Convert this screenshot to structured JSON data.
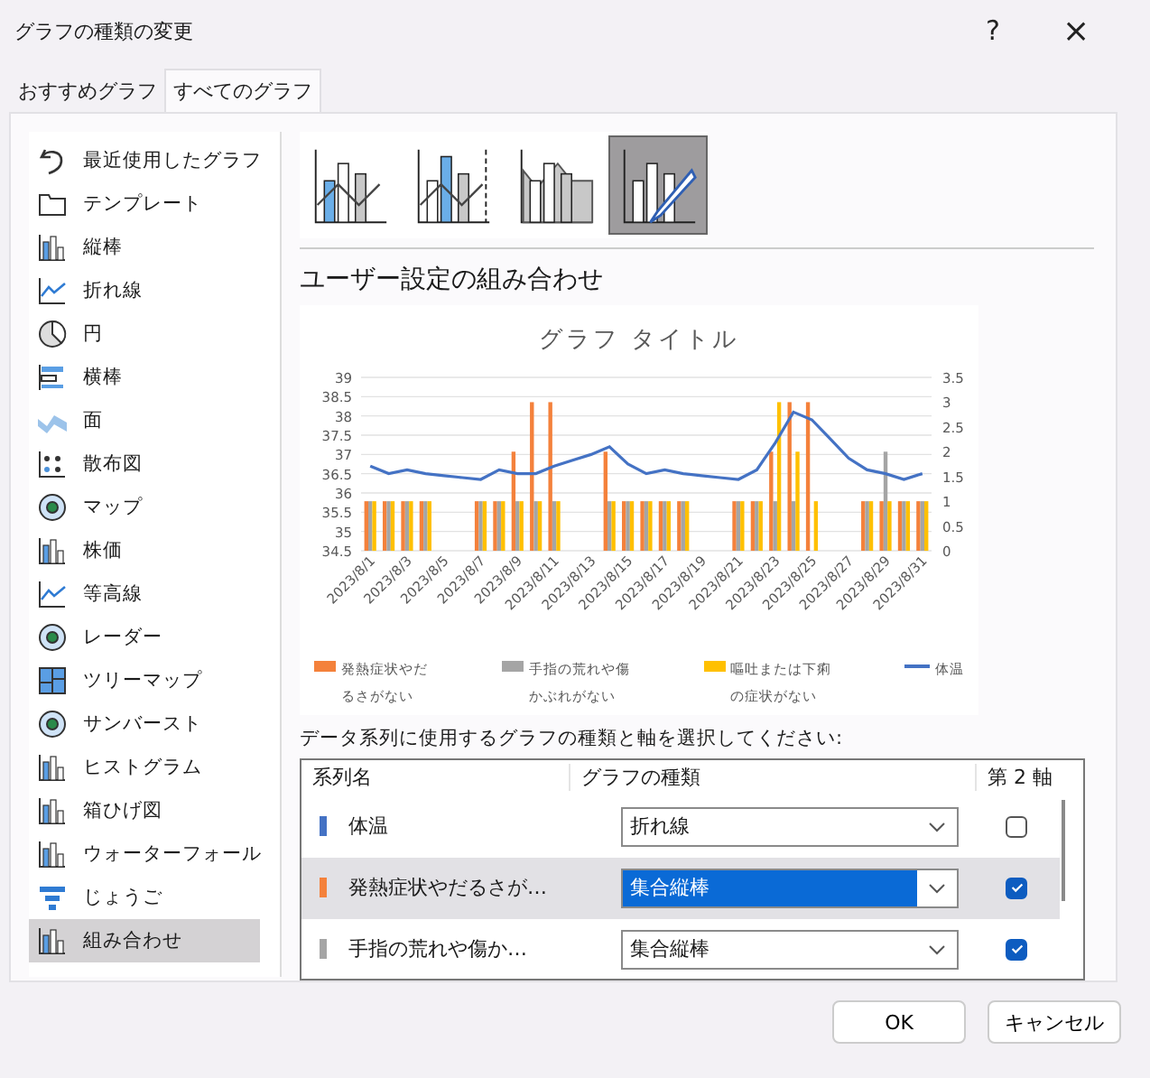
{
  "window": {
    "title": "グラフの種類の変更",
    "help": "?",
    "close": "×"
  },
  "tabs": [
    {
      "label": "おすすめグラフ",
      "selected": false
    },
    {
      "label": "すべてのグラフ",
      "selected": true
    }
  ],
  "sidebar": {
    "items": [
      {
        "label": "最近使用したグラフ",
        "selected": false
      },
      {
        "label": "テンプレート",
        "selected": false
      },
      {
        "label": "縦棒",
        "selected": false
      },
      {
        "label": "折れ線",
        "selected": false
      },
      {
        "label": "円",
        "selected": false
      },
      {
        "label": "横棒",
        "selected": false
      },
      {
        "label": "面",
        "selected": false
      },
      {
        "label": "散布図",
        "selected": false
      },
      {
        "label": "マップ",
        "selected": false
      },
      {
        "label": "株価",
        "selected": false
      },
      {
        "label": "等高線",
        "selected": false
      },
      {
        "label": "レーダー",
        "selected": false
      },
      {
        "label": "ツリーマップ",
        "selected": false
      },
      {
        "label": "サンバースト",
        "selected": false
      },
      {
        "label": "ヒストグラム",
        "selected": false
      },
      {
        "label": "箱ひげ図",
        "selected": false
      },
      {
        "label": "ウォーターフォール",
        "selected": false
      },
      {
        "label": "じょうご",
        "selected": false
      },
      {
        "label": "組み合わせ",
        "selected": true
      }
    ]
  },
  "subtypes": [
    {
      "selected": false
    },
    {
      "selected": false
    },
    {
      "selected": false
    },
    {
      "selected": true
    }
  ],
  "heading": "ユーザー設定の組み合わせ",
  "preview": {
    "chart_data": {
      "type": "bar",
      "title": "グラフ タイトル",
      "stacked": false,
      "grid": true,
      "legend": "bottom",
      "categories": [
        "2023/8/1",
        null,
        "2023/8/3",
        null,
        "2023/8/5",
        null,
        "2023/8/7",
        null,
        "2023/8/9",
        null,
        "2023/8/11",
        null,
        "2023/8/13",
        null,
        "2023/8/15",
        null,
        "2023/8/17",
        null,
        "2023/8/19",
        null,
        "2023/8/21",
        null,
        "2023/8/23",
        null,
        "2023/8/25",
        null,
        "2023/8/27",
        null,
        "2023/8/29",
        null,
        "2023/8/31"
      ],
      "ylim": [
        34.5,
        39
      ],
      "yticks": [
        {
          "value": 34.5,
          "label": "34.5"
        },
        {
          "value": 35,
          "label": "35"
        },
        {
          "value": 35.5,
          "label": "35.5"
        },
        {
          "value": 36,
          "label": "36"
        },
        {
          "value": 36.5,
          "label": "36.5"
        },
        {
          "value": 37,
          "label": "37"
        },
        {
          "value": 37.5,
          "label": "37.5"
        },
        {
          "value": 38,
          "label": "38"
        },
        {
          "value": 38.5,
          "label": "38.5"
        },
        {
          "value": 39,
          "label": "39"
        }
      ],
      "y2lim": [
        0,
        3.5
      ],
      "y2ticks": [
        {
          "value": 0,
          "label": "0"
        },
        {
          "value": 0.5,
          "label": "0.5"
        },
        {
          "value": 1,
          "label": "1"
        },
        {
          "value": 1.5,
          "label": "1.5"
        },
        {
          "value": 2,
          "label": "2"
        },
        {
          "value": 2.5,
          "label": "2.5"
        },
        {
          "value": 3,
          "label": "3"
        },
        {
          "value": 3.5,
          "label": "3.5"
        }
      ],
      "series": [
        {
          "name": "発熱症状やだるさがない",
          "color": "#f4813b",
          "type": "bar",
          "axis": "y2",
          "values": [
            1,
            1,
            1,
            1,
            null,
            null,
            1,
            1,
            2,
            3,
            3,
            null,
            null,
            2,
            1,
            1,
            1,
            1,
            null,
            null,
            1,
            1,
            2,
            3,
            3,
            null,
            null,
            1,
            1,
            1,
            1
          ]
        },
        {
          "name": "手指の荒れや傷かぶれがない",
          "color": "#a5a5a5",
          "type": "bar",
          "axis": "y2",
          "values": [
            1,
            1,
            1,
            1,
            null,
            null,
            1,
            1,
            1,
            1,
            1,
            null,
            null,
            1,
            1,
            1,
            1,
            1,
            null,
            null,
            1,
            1,
            1,
            1,
            null,
            null,
            null,
            1,
            2,
            1,
            1
          ]
        },
        {
          "name": "嘔吐または下痢の症状がない",
          "color": "#ffc000",
          "type": "bar",
          "axis": "y2",
          "values": [
            1,
            1,
            1,
            1,
            null,
            null,
            1,
            1,
            1,
            1,
            1,
            null,
            null,
            1,
            1,
            1,
            1,
            1,
            null,
            null,
            1,
            1,
            3,
            2,
            1,
            null,
            null,
            1,
            1,
            1,
            1
          ]
        },
        {
          "name": "体温",
          "color": "#4472c4",
          "type": "line",
          "values": [
            36.7,
            36.5,
            36.6,
            36.5,
            36.45,
            36.4,
            36.35,
            36.6,
            36.5,
            36.5,
            36.7,
            36.85,
            37.0,
            37.2,
            36.75,
            36.5,
            36.6,
            36.5,
            36.45,
            36.4,
            36.35,
            36.6,
            37.3,
            38.1,
            37.9,
            37.4,
            36.9,
            36.6,
            36.5,
            36.35,
            36.5
          ]
        }
      ]
    }
  },
  "instruction": "データ系列に使用するグラフの種類と軸を選択してください:",
  "table": {
    "columns": [
      "系列名",
      "グラフの種類",
      "第 2 軸"
    ],
    "rows": [
      {
        "name": "体温",
        "color": "#4472c4",
        "chart_type": "折れ線",
        "secondary_axis": false,
        "selected": false
      },
      {
        "name": "発熱症状やだるさが…",
        "color": "#f4813b",
        "chart_type": "集合縦棒",
        "secondary_axis": true,
        "selected": true
      },
      {
        "name": "手指の荒れや傷か…",
        "color": "#a5a5a5",
        "chart_type": "集合縦棒",
        "secondary_axis": true,
        "selected": false
      }
    ]
  },
  "buttons": [
    "OK",
    "キャンセル"
  ]
}
